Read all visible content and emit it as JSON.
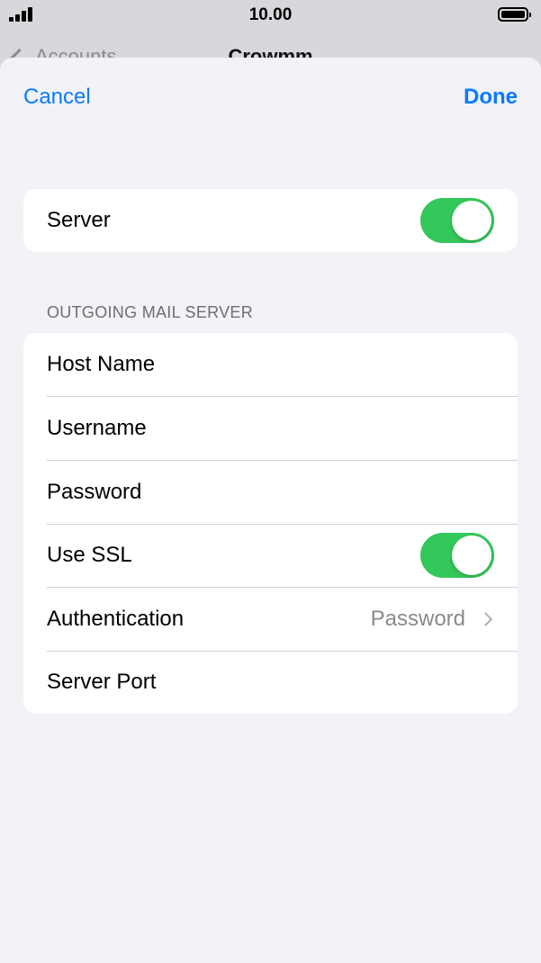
{
  "status_bar": {
    "time": "10.00",
    "signal_icon": "signal-bars-icon",
    "battery_icon": "battery-icon"
  },
  "background_nav": {
    "back_label": "Accounts",
    "title": "Crowmm"
  },
  "nav": {
    "cancel_label": "Cancel",
    "done_label": "Done"
  },
  "server_group": {
    "server_label": "Server",
    "server_enabled": true
  },
  "outgoing": {
    "header": "OUTGOING MAIL SERVER",
    "host_name_label": "Host Name",
    "username_label": "Username",
    "password_label": "Password",
    "use_ssl_label": "Use SSL",
    "use_ssl_enabled": true,
    "authentication_label": "Authentication",
    "authentication_value": "Password",
    "server_port_label": "Server Port"
  },
  "colors": {
    "accent": "#0a7aff",
    "toggle_on": "#34c759",
    "background": "#f2f2f7",
    "secondary_text": "#8a8a8e"
  }
}
